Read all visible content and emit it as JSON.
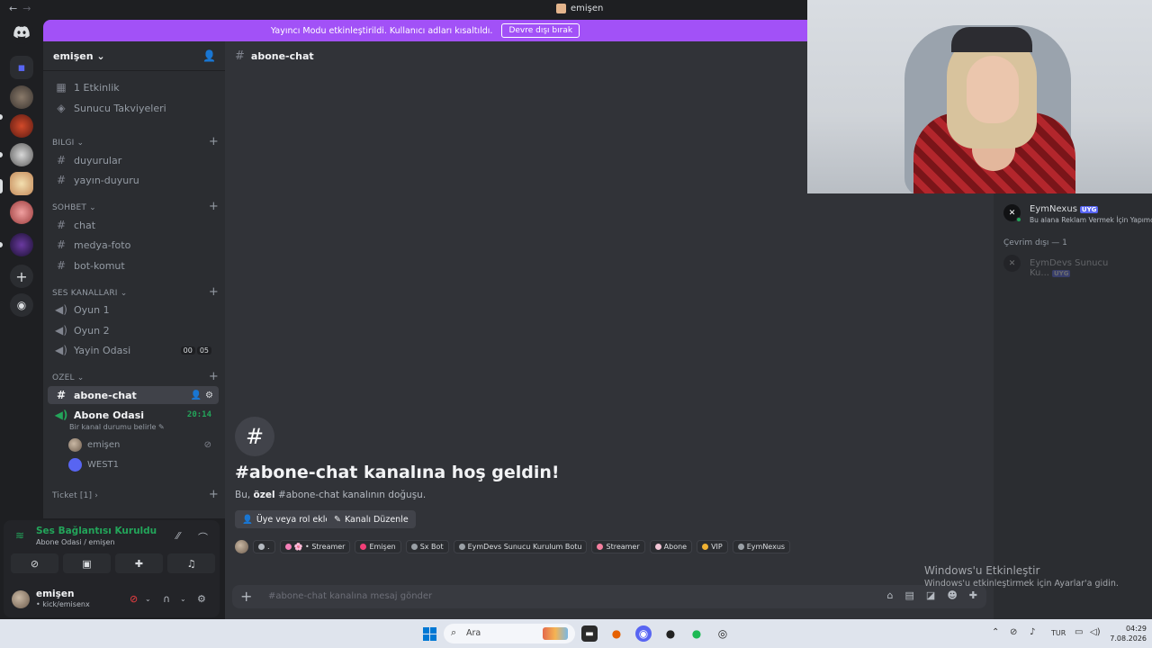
{
  "window": {
    "title": "emişen",
    "back": "←",
    "forward": "→"
  },
  "banner": {
    "text": "Yayıncı Modu etkinleştirildi. Kullanıcı adları kısaltıldı.",
    "button": "Devre dışı bırak"
  },
  "server": {
    "name": "emişen ⌄"
  },
  "sidebar": {
    "events": "1 Etkinlik",
    "boosts": "Sunucu Takviyeleri",
    "categories": {
      "bilgi": "BILGI ⌄",
      "sohbet": "SOHBET ⌄",
      "ses": "SES KANALLARI ⌄",
      "ozel": "OZEL ⌄",
      "ticket": "Ticket [1] ›"
    },
    "channels": {
      "duyurular": "duyurular",
      "yayin_duyuru": "yayın-duyuru",
      "chat": "chat",
      "medya_foto": "medya-foto",
      "bot_komut": "bot-komut",
      "oyun1": "Oyun 1",
      "oyun2": "Oyun 2",
      "yayin_odasi": "Yayin Odasi",
      "abone_chat": "abone-chat",
      "abone_odasi": "Abone Odasi"
    },
    "yayin_badge": [
      "00",
      "05"
    ],
    "abone_timer": "20:14",
    "abone_sub": "Bir kanal durumu belirle ✎",
    "voice_users": [
      "emişen",
      "WEST1"
    ]
  },
  "voice_panel": {
    "status": "Ses Bağlantısı Kuruldu",
    "location": "Abone Odasi / emişen"
  },
  "user_panel": {
    "name": "emişen",
    "status": "• kick/emisenx"
  },
  "chat": {
    "channel": "abone-chat",
    "welcome_title": "#abone-chat kanalına hoş geldin!",
    "welcome_pre": "Bu,",
    "welcome_bold": "özel",
    "welcome_post": "#abone-chat kanalının doğuşu.",
    "btn_roles": "Üye veya rol ekle",
    "btn_edit": "Kanalı Düzenle",
    "roles": [
      {
        "label": ".",
        "color": "#b5bac1"
      },
      {
        "label": "🌸 • Streamer",
        "color": "#f47fb8"
      },
      {
        "label": "Emişen",
        "color": "#f23f78"
      },
      {
        "label": "Sx Bot",
        "color": "#9aa0a6"
      },
      {
        "label": "EymDevs Sunucu Kurulum Botu",
        "color": "#9aa0a6"
      },
      {
        "label": "Streamer",
        "color": "#f47f9f"
      },
      {
        "label": "Abone",
        "color": "#f2c6d6"
      },
      {
        "label": "VIP",
        "color": "#f0b232"
      },
      {
        "label": "EymNexus",
        "color": "#9aa0a6"
      }
    ],
    "placeholder": "#abone-chat kanalına mesaj gönder"
  },
  "members": {
    "online_member": {
      "name": "EymNexus",
      "tag": "UYG",
      "status": "Bu alana Reklam Vermek İçin Yapımc"
    },
    "offline_header": "Çevrim dışı — 1",
    "offline_member": {
      "name": "EymDevs Sunucu Ku...",
      "tag": "UYG"
    }
  },
  "activation": {
    "title": "Windows'u Etkinleştir",
    "subtitle": "Windows'u etkinleştirmek için Ayarlar'a gidin."
  },
  "taskbar": {
    "search": "Ara",
    "lang": "TUR",
    "time": "04:29",
    "date": "7.08.2026"
  },
  "colors": {
    "accent": "#a251f7",
    "online": "#23a55a",
    "danger": "#f23f43",
    "blurple": "#5865f2"
  }
}
